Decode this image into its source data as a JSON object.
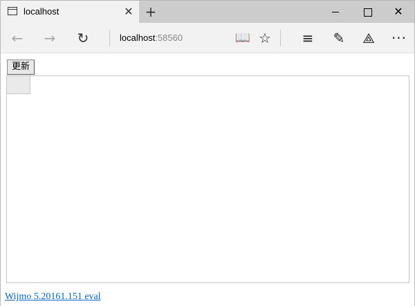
{
  "tab": {
    "title": "localhost",
    "close_glyph": "✕",
    "new_tab_glyph": "+"
  },
  "window_controls": {
    "close_glyph": "✕"
  },
  "nav": {
    "back_glyph": "←",
    "forward_glyph": "→",
    "refresh_glyph": "↻",
    "address_host": "localhost",
    "address_port": ":58560",
    "reading_glyph": "📖",
    "favorite_glyph": "☆",
    "hub_glyph": "≡",
    "note_glyph": "✎",
    "share_glyph": "⟁",
    "more_glyph": "···"
  },
  "page": {
    "update_button_label": "更新",
    "eval_link_text": "Wijmo 5.20161.151 eval"
  }
}
